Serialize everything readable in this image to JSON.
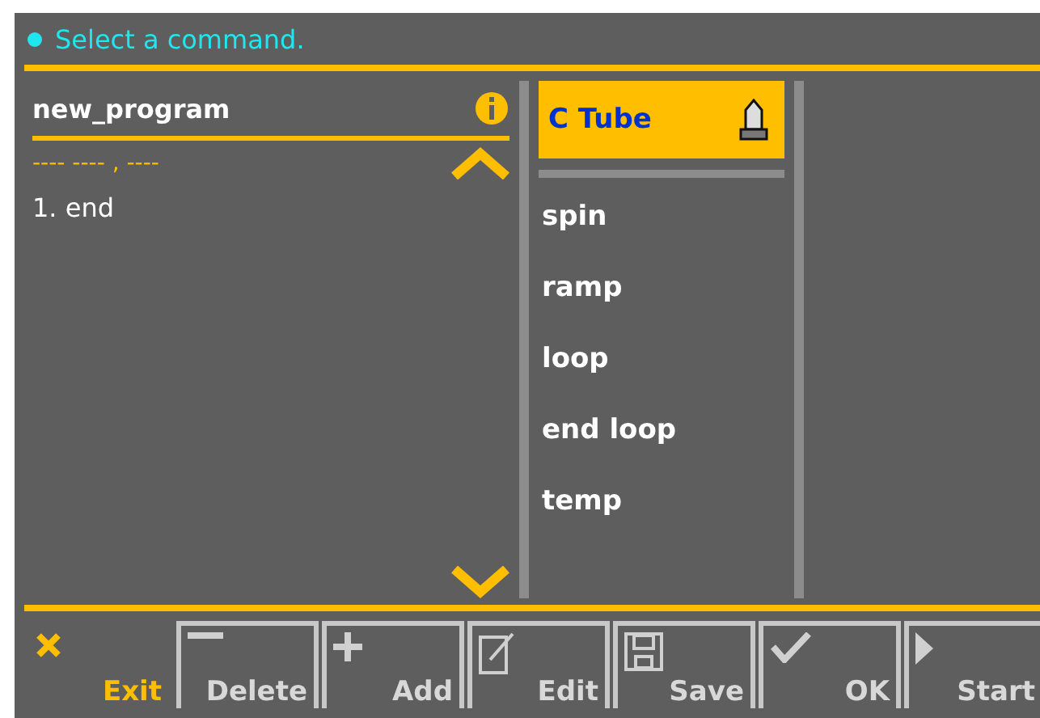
{
  "status": {
    "message": "Select a command."
  },
  "program": {
    "title": "new_program",
    "subtitle": "---- ---- , ----",
    "steps": [
      "1. end"
    ]
  },
  "commands": [
    {
      "label": "C Tube",
      "selected": true
    },
    {
      "label": "spin",
      "selected": false
    },
    {
      "label": "ramp",
      "selected": false
    },
    {
      "label": "loop",
      "selected": false
    },
    {
      "label": "end loop",
      "selected": false
    },
    {
      "label": "temp",
      "selected": false
    }
  ],
  "buttons": [
    {
      "label": "Exit",
      "kind": "close",
      "selected": true
    },
    {
      "label": "Delete",
      "kind": "minus",
      "selected": false
    },
    {
      "label": "Add",
      "kind": "plus",
      "selected": false
    },
    {
      "label": "Edit",
      "kind": "edit",
      "selected": false
    },
    {
      "label": "Save",
      "kind": "save",
      "selected": false
    },
    {
      "label": "OK",
      "kind": "check",
      "selected": false
    },
    {
      "label": "Start",
      "kind": "play",
      "selected": false
    }
  ]
}
